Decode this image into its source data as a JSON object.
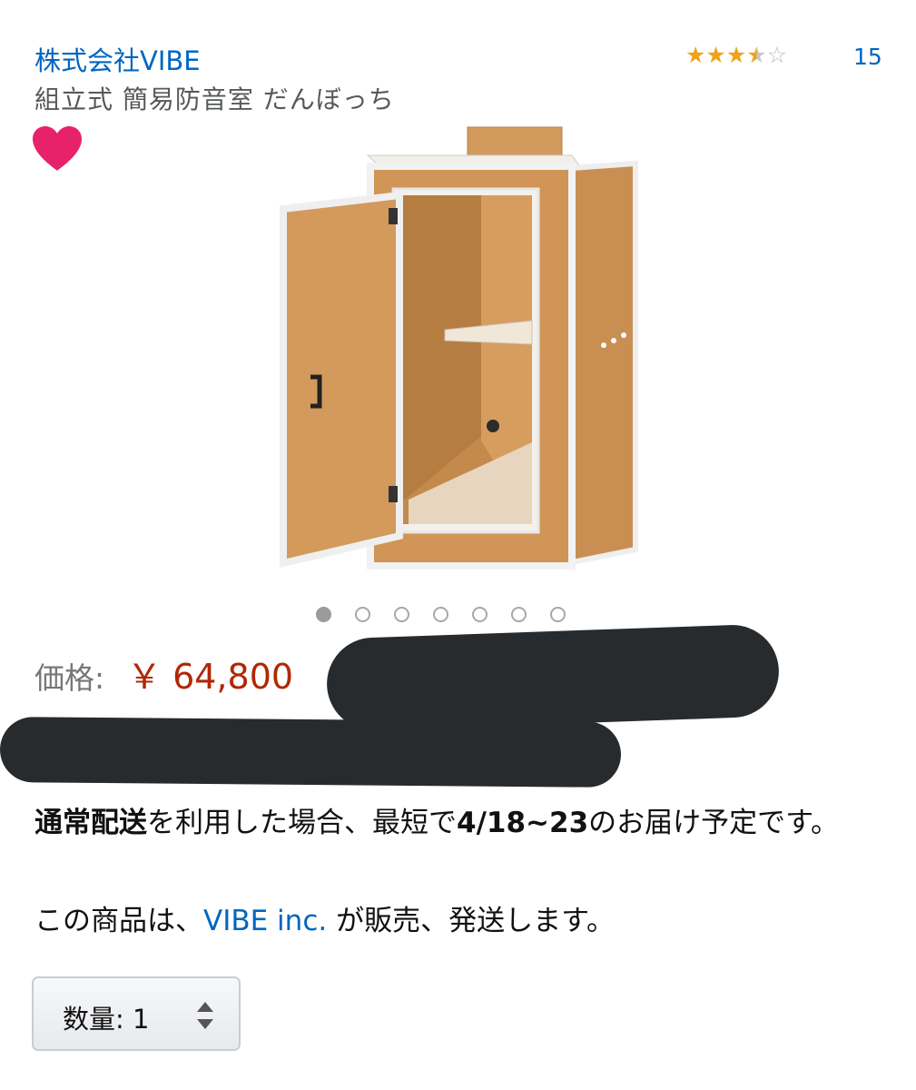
{
  "header": {
    "seller": "株式会社VIBE",
    "title": "組立式 簡易防音室 だんぼっち",
    "rating": 3.5,
    "rating_max": 5,
    "review_count": "15"
  },
  "icons": {
    "wishlist": "heart-icon",
    "rating": "star-icon",
    "quantity_arrows": "up-down-arrows-icon"
  },
  "colors": {
    "link": "#0066c0",
    "price": "#b12704",
    "star": "#f0a21a",
    "heart": "#e8226a"
  },
  "carousel": {
    "count": 7,
    "active": 0
  },
  "price": {
    "label": "価格:",
    "value": "￥ 64,800"
  },
  "delivery": {
    "method": "通常配送",
    "text1": "を利用した場合、最短で",
    "dates": "4/18~23",
    "text2": "のお届け予定です。"
  },
  "sold_by": {
    "prefix": "この商品は、",
    "seller_link": "VIBE inc.",
    "suffix": " が販売、発送します。"
  },
  "quantity": {
    "label": "数量: 1"
  }
}
